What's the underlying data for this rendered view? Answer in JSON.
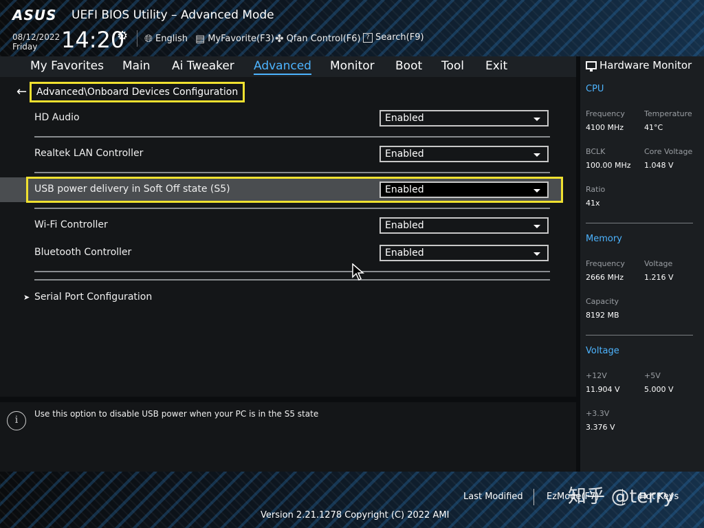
{
  "header": {
    "logo": "ASUS",
    "title": "UEFI BIOS Utility – Advanced Mode",
    "date": "08/12/2022",
    "day": "Friday",
    "time": "14:20",
    "language": "English",
    "my_favorite": "MyFavorite(F3)",
    "qfan": "Qfan Control(F6)",
    "search": "Search(F9)"
  },
  "menu": {
    "items": [
      "My Favorites",
      "Main",
      "Ai Tweaker",
      "Advanced",
      "Monitor",
      "Boot",
      "Tool",
      "Exit"
    ],
    "active": "Advanced"
  },
  "breadcrumb": "Advanced\\Onboard Devices Configuration",
  "settings": [
    {
      "label": "HD Audio",
      "value": "Enabled"
    },
    {
      "label": "Realtek LAN Controller",
      "value": "Enabled"
    },
    {
      "label": "USB power delivery in Soft Off state (S5)",
      "value": "Enabled",
      "selected": true
    },
    {
      "label": "Wi-Fi Controller",
      "value": "Enabled"
    },
    {
      "label": "Bluetooth Controller",
      "value": "Enabled"
    }
  ],
  "submenu": {
    "label": "Serial Port Configuration"
  },
  "help_text": "Use this option to disable USB power when your PC is in the S5 state",
  "hardware_monitor": {
    "title": "Hardware Monitor",
    "cpu": {
      "title": "CPU",
      "frequency_label": "Frequency",
      "frequency": "4100 MHz",
      "temperature_label": "Temperature",
      "temperature": "41°C",
      "bclk_label": "BCLK",
      "bclk": "100.00 MHz",
      "core_voltage_label": "Core Voltage",
      "core_voltage": "1.048 V",
      "ratio_label": "Ratio",
      "ratio": "41x"
    },
    "memory": {
      "title": "Memory",
      "frequency_label": "Frequency",
      "frequency": "2666 MHz",
      "voltage_label": "Voltage",
      "voltage": "1.216 V",
      "capacity_label": "Capacity",
      "capacity": "8192 MB"
    },
    "voltage": {
      "title": "Voltage",
      "v12_label": "+12V",
      "v12": "11.904 V",
      "v5_label": "+5V",
      "v5": "5.000 V",
      "v33_label": "+3.3V",
      "v33": "3.376 V"
    }
  },
  "footer": {
    "last_modified": "Last Modified",
    "ezmode": "EzMode(F7)",
    "hot_keys": "Hot Keys",
    "version": "Version 2.21.1278 Copyright (C) 2022 AMI",
    "watermark": "知乎 @terry"
  },
  "colors": {
    "accent": "#4db4ff",
    "highlight": "#f0e130"
  }
}
